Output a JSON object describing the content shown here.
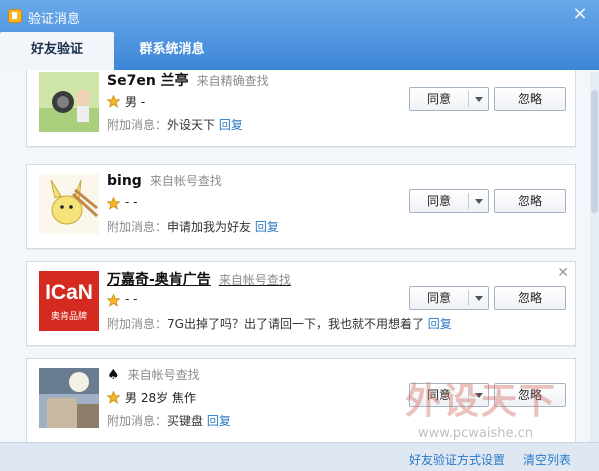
{
  "window": {
    "title": "验证消息",
    "close_glyph": "×"
  },
  "tabs": [
    {
      "label": "好友验证",
      "active": true
    },
    {
      "label": "群系统消息",
      "active": false
    }
  ],
  "cards": [
    {
      "name": "Se7en 兰亭",
      "source": "来自精确查找",
      "info": "男  -",
      "extra_label": "附加消息：",
      "message": "外设天下",
      "reply": "回复",
      "agree": "同意",
      "ignore": "忽略"
    },
    {
      "name": "bing",
      "source": "来自帐号查找",
      "info": "-   -",
      "extra_label": "附加消息：",
      "message": "申请加我为好友",
      "reply": "回复",
      "agree": "同意",
      "ignore": "忽略"
    },
    {
      "name": "万嘉奇-奥肯广告",
      "source": "来自帐号查找",
      "info": "-   -",
      "extra_label": "附加消息：",
      "message": "7G出掉了吗？出了请回一下，我也就不用想着了",
      "reply": "回复",
      "agree": "同意",
      "ignore": "忽略",
      "avatar_text": "ICaN",
      "avatar_subtext": "奥肯品牌"
    },
    {
      "name": "♠",
      "source": "来自帐号查找",
      "info": "男 28岁 焦作",
      "extra_label": "附加消息：",
      "message": "买键盘",
      "reply": "回复",
      "agree": "同意",
      "ignore": "忽略"
    }
  ],
  "footer": {
    "settings_link": "好友验证方式设置",
    "clear_link": "清空列表"
  },
  "watermark": {
    "text": "外设天下",
    "url": "www.pcwaishe.cn"
  },
  "colors": {
    "title_bar": "#3d86d6",
    "link": "#2a79c7",
    "star": "#f5b628"
  }
}
